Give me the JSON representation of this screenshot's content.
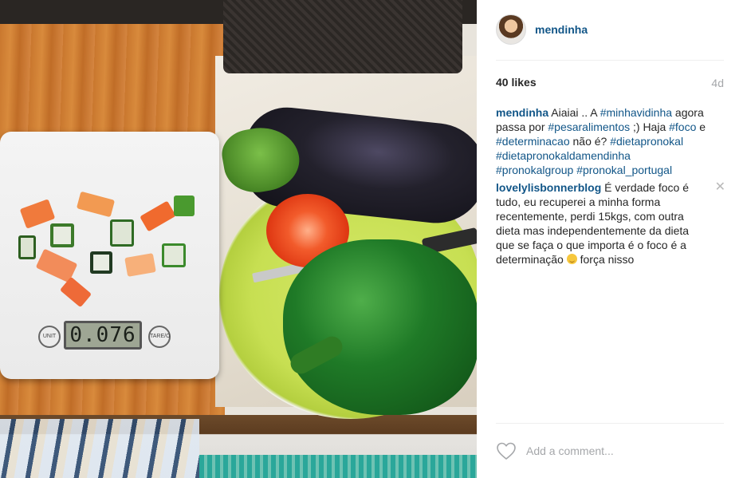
{
  "post": {
    "username": "mendinha",
    "likes": "40 likes",
    "time_ago": "4d",
    "scale_display": "0.076",
    "scale_unit_label": "UNIT",
    "scale_tare_label": "TARE/O"
  },
  "comments": [
    {
      "user": "mendinha",
      "parts": [
        {
          "text": " Aiaiai .. A "
        },
        {
          "tag": "#minhavidinha"
        },
        {
          "text": " agora passa por "
        },
        {
          "tag": "#pesaralimentos"
        },
        {
          "text": " ;) Haja "
        },
        {
          "tag": "#foco"
        },
        {
          "text": " e "
        },
        {
          "tag": "#determinacao"
        },
        {
          "text": " não é? "
        },
        {
          "tag": "#dietapronokal"
        },
        {
          "text": " "
        },
        {
          "tag": "#dietapronokaldamendinha"
        },
        {
          "text": " "
        },
        {
          "tag": "#pronokalgroup"
        },
        {
          "text": " "
        },
        {
          "tag": "#pronokal_portugal"
        }
      ]
    },
    {
      "user": "lovelylisbonnerblog",
      "text_before_emoji": " É verdade foco é tudo, eu recuperei a minha forma recentemente, perdi 15kgs, com outra dieta mas independentemente da dieta que se faça o que importa é o foco é a determinação ",
      "text_after_emoji": " força nisso",
      "close_glyph": "✕"
    }
  ],
  "footer": {
    "add_comment_placeholder": "Add a comment..."
  },
  "icons": {
    "heart": "heart-icon",
    "close": "close-icon",
    "emoji": "smiling-face-emoji"
  }
}
